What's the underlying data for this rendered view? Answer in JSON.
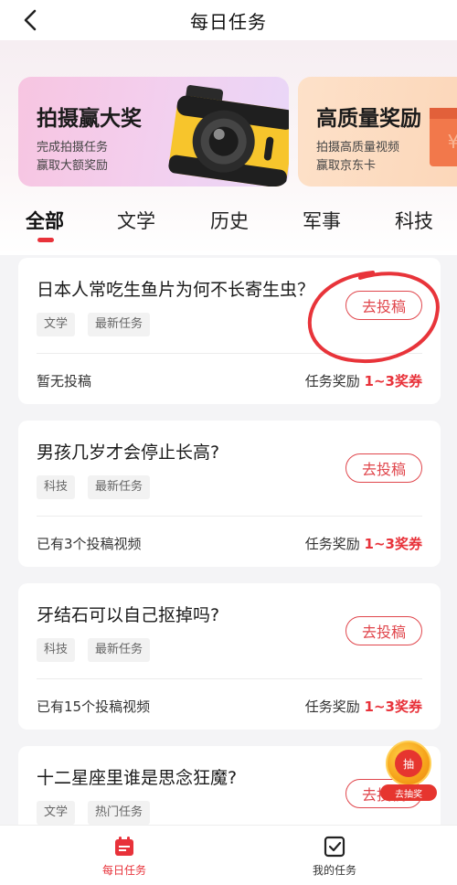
{
  "header": {
    "title": "每日任务"
  },
  "banners": [
    {
      "title": "拍摄赢大奖",
      "line1": "完成拍摄任务",
      "line2": "赢取大额奖励"
    },
    {
      "title": "高质量奖励",
      "line1": "拍摄高质量视频",
      "line2": "赢取京东卡"
    }
  ],
  "tabs": [
    "全部",
    "文学",
    "历史",
    "军事",
    "科技"
  ],
  "active_tab": "全部",
  "cards": [
    {
      "title": "日本人常吃生鱼片为何不长寄生虫？",
      "tags": [
        "文学",
        "最新任务"
      ],
      "button": "去投稿",
      "status": "暂无投稿",
      "reward_label": "任务奖励",
      "reward_amount": "1~3奖券"
    },
    {
      "title": "男孩几岁才会停止长高?",
      "tags": [
        "科技",
        "最新任务"
      ],
      "button": "去投稿",
      "status": "已有3个投稿视频",
      "reward_label": "任务奖励",
      "reward_amount": "1~3奖券"
    },
    {
      "title": "牙结石可以自己抠掉吗?",
      "tags": [
        "科技",
        "最新任务"
      ],
      "button": "去投稿",
      "status": "已有15个投稿视频",
      "reward_label": "任务奖励",
      "reward_amount": "1~3奖券"
    },
    {
      "title": "十二星座里谁是思念狂魔?",
      "tags": [
        "文学",
        "热门任务"
      ],
      "button": "去投稿"
    }
  ],
  "float_badge": {
    "coin_text": "抽",
    "label": "去抽奖"
  },
  "bottom_nav": [
    {
      "label": "每日任务",
      "active": true
    },
    {
      "label": "我的任务",
      "active": false
    }
  ],
  "colors": {
    "accent": "#e8323a",
    "button_border": "#e0464c"
  },
  "icons": [
    "back-arrow-icon",
    "camera-icon",
    "gift-icon",
    "calendar-icon",
    "task-check-icon",
    "lottery-coin-icon"
  ]
}
